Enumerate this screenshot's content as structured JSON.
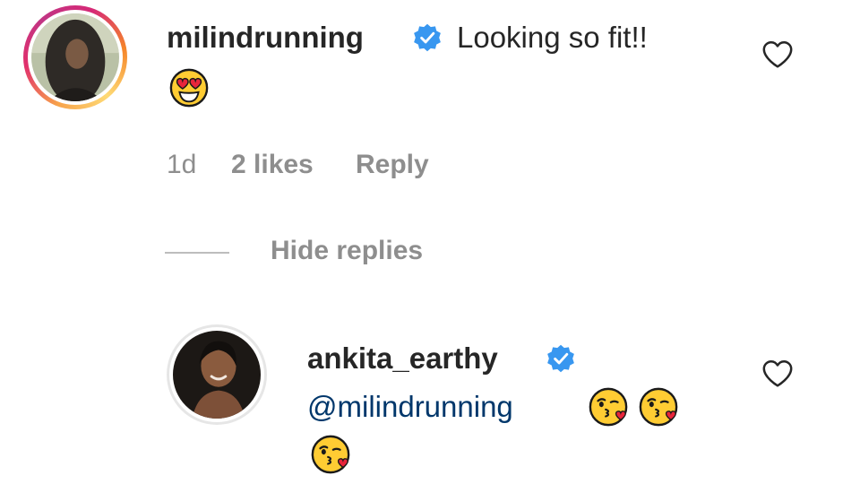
{
  "comment": {
    "username": "milindrunning",
    "text": "Looking so fit!!",
    "emoji": "smiling-face-with-heart-eyes",
    "meta": {
      "time": "1d",
      "likes": "2 likes",
      "reply_label": "Reply"
    },
    "hide_replies_label": "Hide replies"
  },
  "reply": {
    "username": "ankita_earthy",
    "mention": "@milindrunning",
    "emojis": [
      "face-blowing-a-kiss",
      "face-blowing-a-kiss",
      "face-blowing-a-kiss"
    ]
  },
  "colors": {
    "text_primary": "#262626",
    "text_secondary": "#8e8e8e",
    "mention": "#00376b",
    "verified": "#3897f0"
  }
}
